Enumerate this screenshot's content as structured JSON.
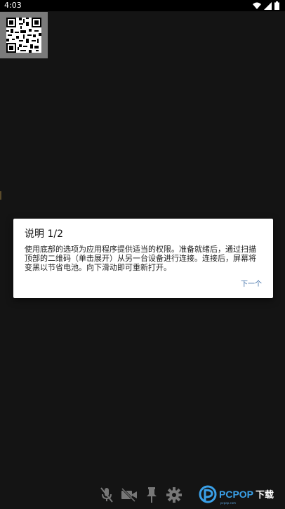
{
  "status_bar": {
    "time": "4:03",
    "icons": [
      "wifi-icon",
      "signal-icon",
      "battery-icon"
    ]
  },
  "qr_tile": {
    "icon": "qr-code-icon"
  },
  "dialog": {
    "title": "说明 1/2",
    "body": "使用底部的选项为应用程序提供适当的权限。准备就绪后，通过扫描顶部的二维码（单击展开）从另一台设备进行连接。连接后，屏幕将变黑以节省电池。向下滑动即可重新打开。",
    "next_label": "下一个",
    "accent_color": "#3f6fa8"
  },
  "bottom_bar": {
    "buttons": [
      "mic-off-icon",
      "video-off-icon",
      "pin-icon",
      "gear-icon"
    ]
  },
  "watermark": {
    "brand": "PCPOP下载"
  }
}
